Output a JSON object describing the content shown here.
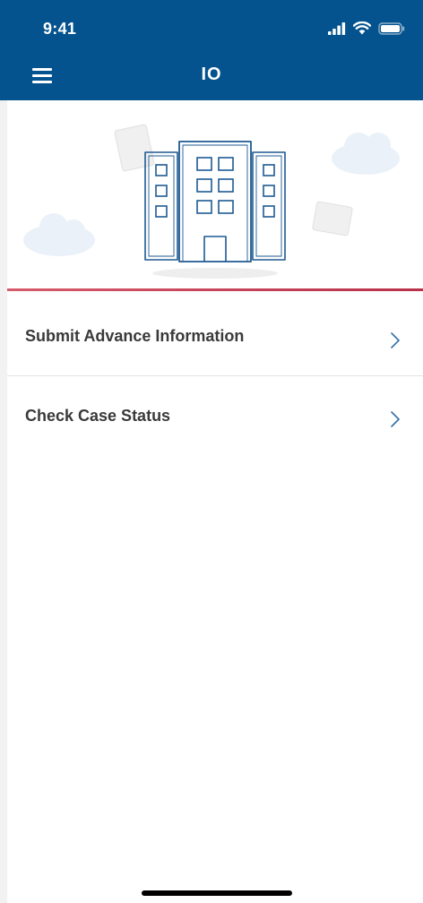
{
  "status_bar": {
    "time": "9:41",
    "icons": [
      "signal-icon",
      "wifi-icon",
      "battery-icon"
    ]
  },
  "nav": {
    "title": "IO",
    "menu_icon": "hamburger-menu-icon"
  },
  "hero": {
    "illustration": "office-building-icon"
  },
  "menu": {
    "items": [
      {
        "label": "Submit Advance Information",
        "icon": "chevron-right-icon"
      },
      {
        "label": "Check Case Status",
        "icon": "chevron-right-icon"
      }
    ]
  },
  "colors": {
    "header_blue": "#04528e",
    "accent_red": "#c2384e",
    "illustration_blue": "#1e5a92",
    "text_dark": "#3a3a3a"
  }
}
